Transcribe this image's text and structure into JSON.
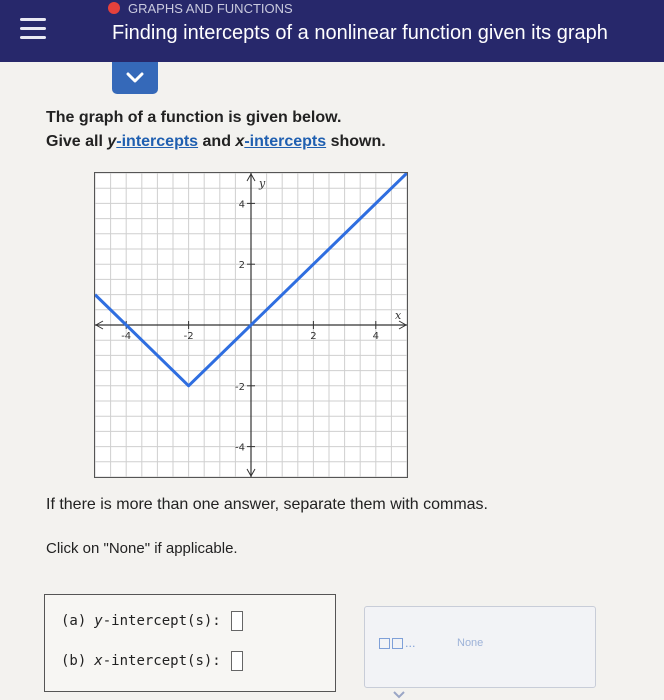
{
  "header": {
    "topic": "GRAPHS AND FUNCTIONS",
    "title": "Finding intercepts of a nonlinear function given its graph"
  },
  "prompt": {
    "line1": "The graph of a function is given below.",
    "line2_a": "Give all ",
    "line2_y": "y",
    "line2_b": "-intercepts",
    "line2_c": " and ",
    "line2_x": "x",
    "line2_d": "-intercepts",
    "line2_e": " shown."
  },
  "graph": {
    "x_axis_label": "x",
    "y_axis_label": "y",
    "x_tick_labels": [
      "-4",
      "-2",
      "2",
      "4"
    ],
    "y_tick_labels": [
      "4",
      "2",
      "-2",
      "-4"
    ],
    "line_color": "#2f6ee0"
  },
  "chart_data": {
    "type": "line",
    "title": "",
    "xlabel": "x",
    "ylabel": "y",
    "xlim": [
      -5,
      5
    ],
    "ylim": [
      -5,
      5
    ],
    "grid": true,
    "series": [
      {
        "x": [
          -5,
          -2,
          5
        ],
        "y": [
          1,
          -2,
          5
        ]
      }
    ]
  },
  "instructions": {
    "separator": "If there is more than one answer, separate them with commas.",
    "none_hint": "Click on \"None\" if applicable."
  },
  "answers": {
    "a_part": "(a)",
    "a_var": "y",
    "a_label": "-intercept(s):",
    "b_part": "(b)",
    "b_var": "x",
    "b_label": "-intercept(s):"
  },
  "tools": {
    "none_label": "None",
    "ellipsis": "..."
  }
}
